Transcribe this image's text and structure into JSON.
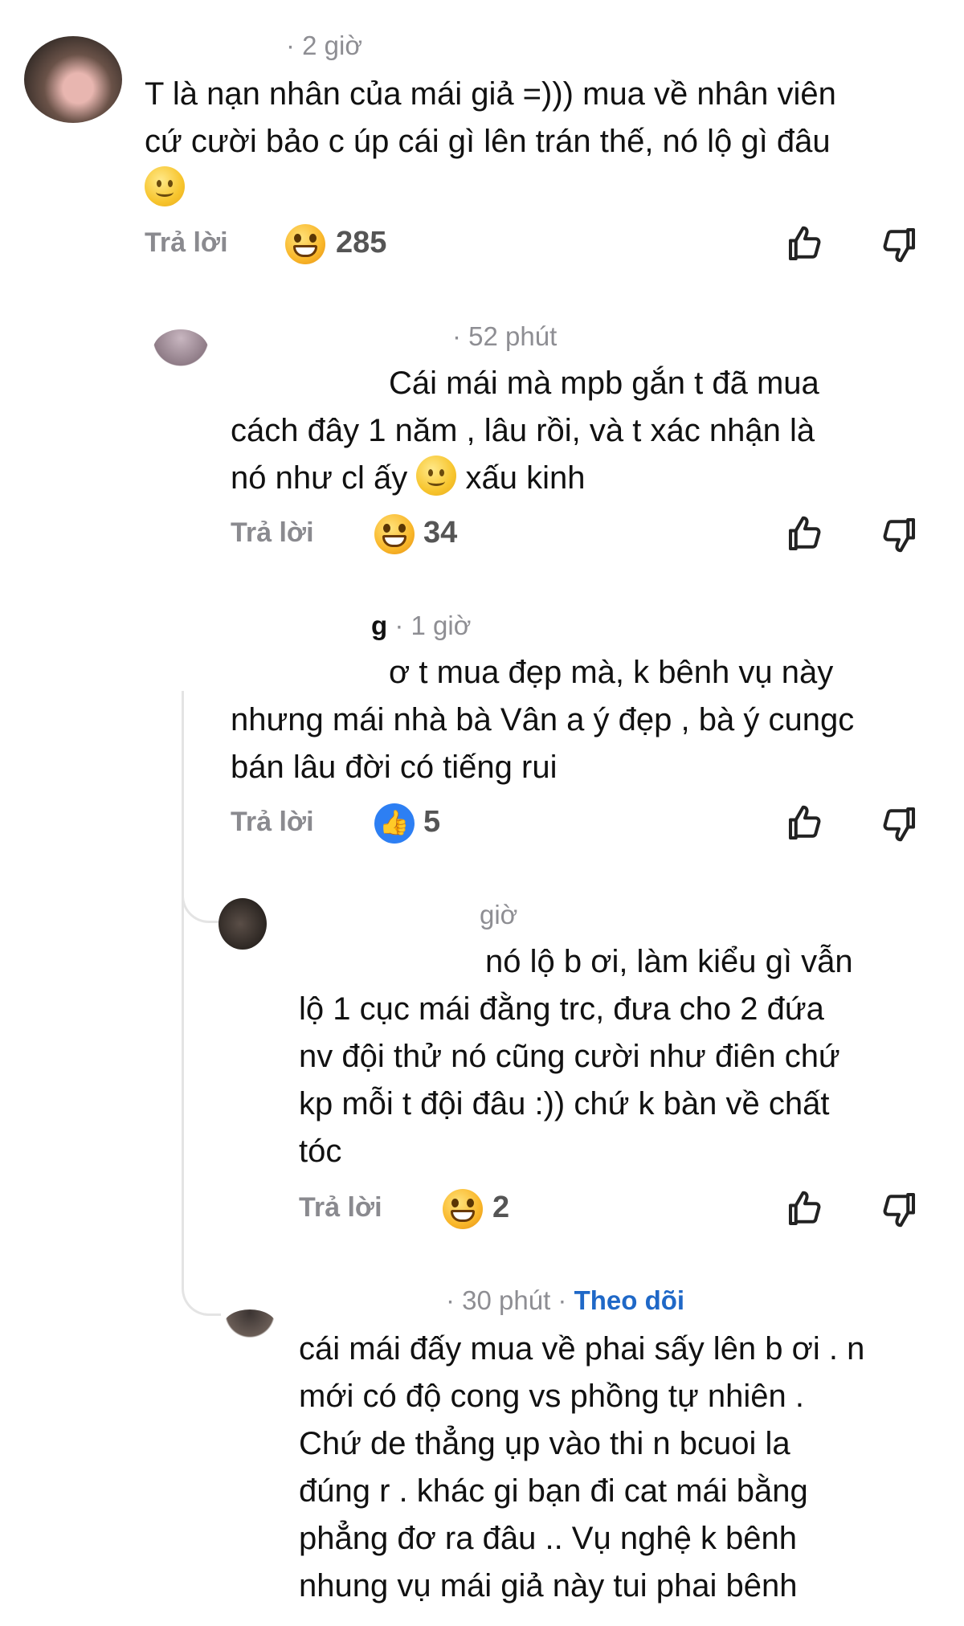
{
  "reply_label": "Trả lời",
  "comments": [
    {
      "time": "· 2 giờ",
      "lines": [
        "T là nạn nhân của mái giả =))) mua về nhân viên",
        "cứ cười bảo c úp cái gì lên trán thế, nó lộ gì đâu"
      ],
      "reaction": {
        "type": "laugh",
        "count": "285"
      }
    },
    {
      "time": "· 52 phút",
      "lines": [
        "Cái mái mà mpb gắn t đã mua",
        "cách đây 1 năm , lâu rồi, và t xác nhận là"
      ],
      "line3_before": "nó như cl ấy",
      "line3_after": "xấu kinh",
      "reaction": {
        "type": "laugh",
        "count": "34"
      }
    },
    {
      "name_tail": "g",
      "time": "· 1 giờ",
      "lines": [
        "ơ t mua đẹp mà, k bênh vụ này",
        "nhưng mái nhà bà Vân a ý đẹp , bà ý cungc",
        "bán lâu đời có tiếng rui"
      ],
      "reaction": {
        "type": "like",
        "count": "5"
      }
    },
    {
      "time": "giờ",
      "lines": [
        "nó lộ b ơi, làm kiểu gì vẫn",
        "lộ 1 cục mái đằng trc, đưa cho 2 đứa",
        "nv đội thử nó cũng cười như điên chứ",
        "kp mỗi t đội đâu :)) chứ k bàn về chất",
        "tóc"
      ],
      "reaction": {
        "type": "laugh",
        "count": "2"
      }
    },
    {
      "time": "· 30 phút ·",
      "follow": "Theo dõi",
      "lines": [
        "cái mái đấy mua về phai sấy lên b ơi . n",
        "mới có độ cong vs phồng tự nhiên .",
        "Chứ de thẳng ụp vào thi n bcuoi la",
        "đúng r . khác gi bạn đi cat mái bằng",
        "phẳng đơ ra đâu .. Vụ nghệ k bênh",
        "nhung vụ mái giả này tui phai bênh"
      ]
    }
  ]
}
